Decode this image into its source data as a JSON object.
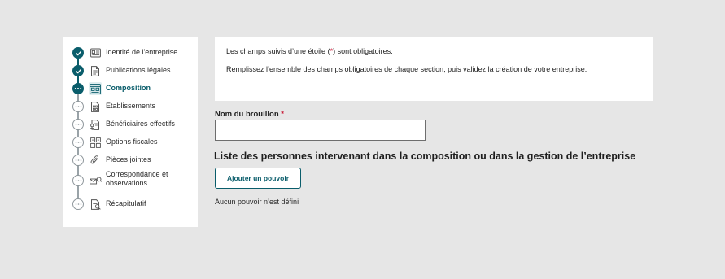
{
  "stepper": {
    "steps": [
      {
        "label": "Identité de l'entreprise",
        "status": "done",
        "icon": "id-card-icon"
      },
      {
        "label": "Publications légales",
        "status": "done",
        "icon": "document-icon"
      },
      {
        "label": "Composition",
        "status": "current",
        "icon": "org-chart-icon"
      },
      {
        "label": "Établissements",
        "status": "todo",
        "icon": "building-icon"
      },
      {
        "label": "Bénéficiaires effectifs",
        "status": "todo",
        "icon": "beneficiaries-icon"
      },
      {
        "label": "Options fiscales",
        "status": "todo",
        "icon": "tax-grid-icon"
      },
      {
        "label": "Pièces jointes",
        "status": "todo",
        "icon": "paperclip-icon"
      },
      {
        "label": "Correspondance et observations",
        "status": "todo",
        "icon": "envelope-icon"
      },
      {
        "label": "Récapitulatif",
        "status": "todo",
        "icon": "summary-icon"
      }
    ]
  },
  "info": {
    "line1_before": "Les champs suivis d’une étoile (",
    "line1_star": "*",
    "line1_after": ") sont obligatoires.",
    "line2": "Remplissez l’ensemble des champs obligatoires de chaque section, puis validez la création de votre entreprise."
  },
  "draft": {
    "label": "Nom du brouillon",
    "required_mark": "*",
    "value": ""
  },
  "composition": {
    "title": "Liste des personnes intervenant dans la composition ou dans la gestion de l’entreprise",
    "add_button": "Ajouter un pouvoir",
    "empty_text": "Aucun pouvoir n’est défini"
  },
  "colors": {
    "accent": "#0a5d6b",
    "required": "#c8102e",
    "background": "#e6e6e6"
  }
}
